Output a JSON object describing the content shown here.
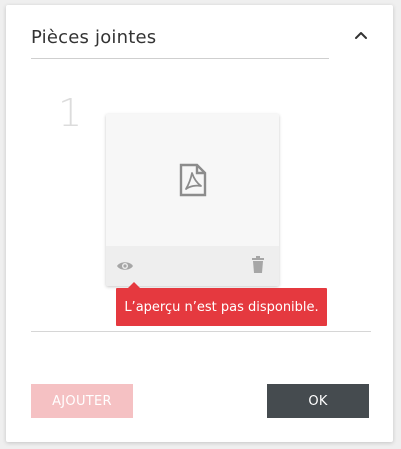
{
  "attachments": {
    "title": "Pièces jointes",
    "collapse_icon": "chevron-up-icon",
    "items": [
      {
        "index": "1",
        "file_type_icon": "pdf-file-icon",
        "preview_action_icon": "eye-icon",
        "delete_action_icon": "trash-icon"
      }
    ],
    "tooltip": "L’aperçu n’est pas disponible."
  },
  "footer": {
    "add_label": "AJOUTER",
    "ok_label": "OK"
  },
  "colors": {
    "accent_red": "#e5393f",
    "add_button_disabled": "#f5c1c3",
    "ok_button": "#454b4f"
  }
}
